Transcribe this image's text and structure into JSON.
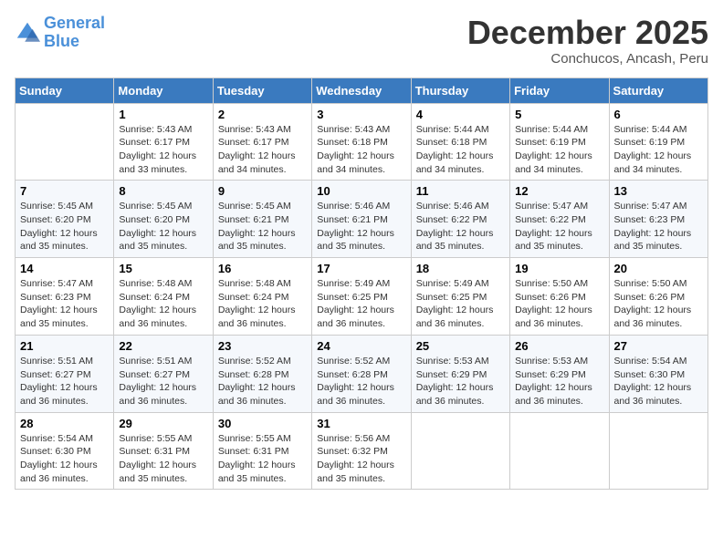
{
  "logo": {
    "line1": "General",
    "line2": "Blue"
  },
  "title": "December 2025",
  "subtitle": "Conchucos, Ancash, Peru",
  "days_of_week": [
    "Sunday",
    "Monday",
    "Tuesday",
    "Wednesday",
    "Thursday",
    "Friday",
    "Saturday"
  ],
  "weeks": [
    [
      {
        "day": "",
        "sunrise": "",
        "sunset": "",
        "daylight": ""
      },
      {
        "day": "1",
        "sunrise": "Sunrise: 5:43 AM",
        "sunset": "Sunset: 6:17 PM",
        "daylight": "Daylight: 12 hours and 33 minutes."
      },
      {
        "day": "2",
        "sunrise": "Sunrise: 5:43 AM",
        "sunset": "Sunset: 6:17 PM",
        "daylight": "Daylight: 12 hours and 34 minutes."
      },
      {
        "day": "3",
        "sunrise": "Sunrise: 5:43 AM",
        "sunset": "Sunset: 6:18 PM",
        "daylight": "Daylight: 12 hours and 34 minutes."
      },
      {
        "day": "4",
        "sunrise": "Sunrise: 5:44 AM",
        "sunset": "Sunset: 6:18 PM",
        "daylight": "Daylight: 12 hours and 34 minutes."
      },
      {
        "day": "5",
        "sunrise": "Sunrise: 5:44 AM",
        "sunset": "Sunset: 6:19 PM",
        "daylight": "Daylight: 12 hours and 34 minutes."
      },
      {
        "day": "6",
        "sunrise": "Sunrise: 5:44 AM",
        "sunset": "Sunset: 6:19 PM",
        "daylight": "Daylight: 12 hours and 34 minutes."
      }
    ],
    [
      {
        "day": "7",
        "sunrise": "Sunrise: 5:45 AM",
        "sunset": "Sunset: 6:20 PM",
        "daylight": "Daylight: 12 hours and 35 minutes."
      },
      {
        "day": "8",
        "sunrise": "Sunrise: 5:45 AM",
        "sunset": "Sunset: 6:20 PM",
        "daylight": "Daylight: 12 hours and 35 minutes."
      },
      {
        "day": "9",
        "sunrise": "Sunrise: 5:45 AM",
        "sunset": "Sunset: 6:21 PM",
        "daylight": "Daylight: 12 hours and 35 minutes."
      },
      {
        "day": "10",
        "sunrise": "Sunrise: 5:46 AM",
        "sunset": "Sunset: 6:21 PM",
        "daylight": "Daylight: 12 hours and 35 minutes."
      },
      {
        "day": "11",
        "sunrise": "Sunrise: 5:46 AM",
        "sunset": "Sunset: 6:22 PM",
        "daylight": "Daylight: 12 hours and 35 minutes."
      },
      {
        "day": "12",
        "sunrise": "Sunrise: 5:47 AM",
        "sunset": "Sunset: 6:22 PM",
        "daylight": "Daylight: 12 hours and 35 minutes."
      },
      {
        "day": "13",
        "sunrise": "Sunrise: 5:47 AM",
        "sunset": "Sunset: 6:23 PM",
        "daylight": "Daylight: 12 hours and 35 minutes."
      }
    ],
    [
      {
        "day": "14",
        "sunrise": "Sunrise: 5:47 AM",
        "sunset": "Sunset: 6:23 PM",
        "daylight": "Daylight: 12 hours and 35 minutes."
      },
      {
        "day": "15",
        "sunrise": "Sunrise: 5:48 AM",
        "sunset": "Sunset: 6:24 PM",
        "daylight": "Daylight: 12 hours and 36 minutes."
      },
      {
        "day": "16",
        "sunrise": "Sunrise: 5:48 AM",
        "sunset": "Sunset: 6:24 PM",
        "daylight": "Daylight: 12 hours and 36 minutes."
      },
      {
        "day": "17",
        "sunrise": "Sunrise: 5:49 AM",
        "sunset": "Sunset: 6:25 PM",
        "daylight": "Daylight: 12 hours and 36 minutes."
      },
      {
        "day": "18",
        "sunrise": "Sunrise: 5:49 AM",
        "sunset": "Sunset: 6:25 PM",
        "daylight": "Daylight: 12 hours and 36 minutes."
      },
      {
        "day": "19",
        "sunrise": "Sunrise: 5:50 AM",
        "sunset": "Sunset: 6:26 PM",
        "daylight": "Daylight: 12 hours and 36 minutes."
      },
      {
        "day": "20",
        "sunrise": "Sunrise: 5:50 AM",
        "sunset": "Sunset: 6:26 PM",
        "daylight": "Daylight: 12 hours and 36 minutes."
      }
    ],
    [
      {
        "day": "21",
        "sunrise": "Sunrise: 5:51 AM",
        "sunset": "Sunset: 6:27 PM",
        "daylight": "Daylight: 12 hours and 36 minutes."
      },
      {
        "day": "22",
        "sunrise": "Sunrise: 5:51 AM",
        "sunset": "Sunset: 6:27 PM",
        "daylight": "Daylight: 12 hours and 36 minutes."
      },
      {
        "day": "23",
        "sunrise": "Sunrise: 5:52 AM",
        "sunset": "Sunset: 6:28 PM",
        "daylight": "Daylight: 12 hours and 36 minutes."
      },
      {
        "day": "24",
        "sunrise": "Sunrise: 5:52 AM",
        "sunset": "Sunset: 6:28 PM",
        "daylight": "Daylight: 12 hours and 36 minutes."
      },
      {
        "day": "25",
        "sunrise": "Sunrise: 5:53 AM",
        "sunset": "Sunset: 6:29 PM",
        "daylight": "Daylight: 12 hours and 36 minutes."
      },
      {
        "day": "26",
        "sunrise": "Sunrise: 5:53 AM",
        "sunset": "Sunset: 6:29 PM",
        "daylight": "Daylight: 12 hours and 36 minutes."
      },
      {
        "day": "27",
        "sunrise": "Sunrise: 5:54 AM",
        "sunset": "Sunset: 6:30 PM",
        "daylight": "Daylight: 12 hours and 36 minutes."
      }
    ],
    [
      {
        "day": "28",
        "sunrise": "Sunrise: 5:54 AM",
        "sunset": "Sunset: 6:30 PM",
        "daylight": "Daylight: 12 hours and 36 minutes."
      },
      {
        "day": "29",
        "sunrise": "Sunrise: 5:55 AM",
        "sunset": "Sunset: 6:31 PM",
        "daylight": "Daylight: 12 hours and 35 minutes."
      },
      {
        "day": "30",
        "sunrise": "Sunrise: 5:55 AM",
        "sunset": "Sunset: 6:31 PM",
        "daylight": "Daylight: 12 hours and 35 minutes."
      },
      {
        "day": "31",
        "sunrise": "Sunrise: 5:56 AM",
        "sunset": "Sunset: 6:32 PM",
        "daylight": "Daylight: 12 hours and 35 minutes."
      },
      {
        "day": "",
        "sunrise": "",
        "sunset": "",
        "daylight": ""
      },
      {
        "day": "",
        "sunrise": "",
        "sunset": "",
        "daylight": ""
      },
      {
        "day": "",
        "sunrise": "",
        "sunset": "",
        "daylight": ""
      }
    ]
  ]
}
